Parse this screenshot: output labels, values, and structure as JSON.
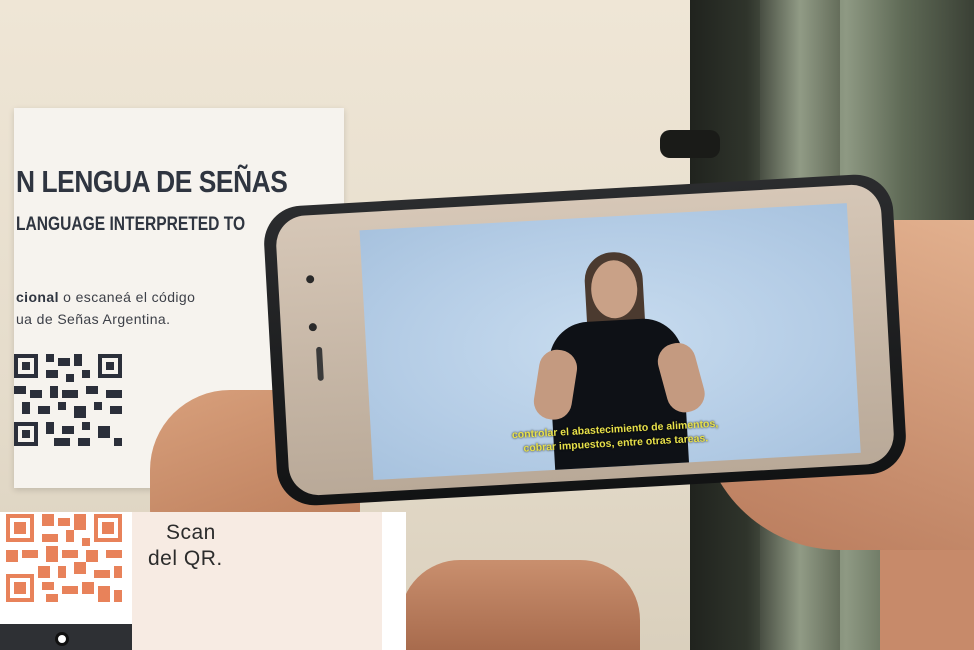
{
  "sign": {
    "title": "N LENGUA DE SEÑAS",
    "subtitle": "LANGUAGE INTERPRETED TO",
    "body_line1_bold": "cional",
    "body_line1_rest": " o escaneá el código",
    "body_line2": "ua de Señas Argentina."
  },
  "phone_video": {
    "subtitle_line1": "controlar el abastecimiento de alimentos,",
    "subtitle_line2": "cobrar impuestos, entre otras tareas."
  },
  "scan_card": {
    "line1": "Scan",
    "line2": "del QR.",
    "qr_color": "#e8825a",
    "bg_color": "#f7ebe3"
  }
}
